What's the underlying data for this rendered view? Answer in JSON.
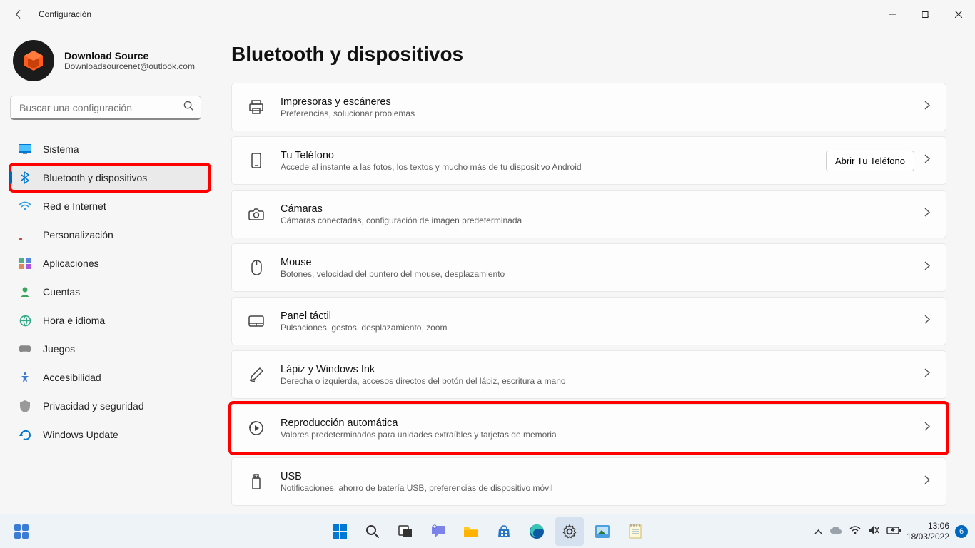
{
  "window": {
    "title": "Configuración"
  },
  "account": {
    "name": "Download Source",
    "email": "Downloadsourcenet@outlook.com"
  },
  "search": {
    "placeholder": "Buscar una configuración"
  },
  "nav": {
    "sistema": "Sistema",
    "bluetooth": "Bluetooth y dispositivos",
    "red": "Red e Internet",
    "personalizacion": "Personalización",
    "aplicaciones": "Aplicaciones",
    "cuentas": "Cuentas",
    "hora": "Hora e idioma",
    "juegos": "Juegos",
    "accesibilidad": "Accesibilidad",
    "privacidad": "Privacidad y seguridad",
    "update": "Windows Update"
  },
  "main": {
    "heading": "Bluetooth y dispositivos",
    "phone_button": "Abrir Tu Teléfono",
    "cards": {
      "impresoras": {
        "title": "Impresoras y escáneres",
        "sub": "Preferencias, solucionar problemas"
      },
      "telefono": {
        "title": "Tu Teléfono",
        "sub": "Accede al instante a las fotos, los textos y mucho más de tu dispositivo Android"
      },
      "camaras": {
        "title": "Cámaras",
        "sub": "Cámaras conectadas, configuración de imagen predeterminada"
      },
      "mouse": {
        "title": "Mouse",
        "sub": "Botones, velocidad del puntero del mouse, desplazamiento"
      },
      "panel": {
        "title": "Panel táctil",
        "sub": "Pulsaciones, gestos, desplazamiento, zoom"
      },
      "lapiz": {
        "title": "Lápiz y Windows Ink",
        "sub": "Derecha o izquierda, accesos directos del botón del lápiz, escritura a mano"
      },
      "repro": {
        "title": "Reproducción automática",
        "sub": "Valores predeterminados para unidades extraíbles y tarjetas de memoria"
      },
      "usb": {
        "title": "USB",
        "sub": "Notificaciones, ahorro de batería USB, preferencias de dispositivo móvil"
      }
    }
  },
  "taskbar": {
    "time": "13:06",
    "date": "18/03/2022",
    "notif_count": "6"
  }
}
